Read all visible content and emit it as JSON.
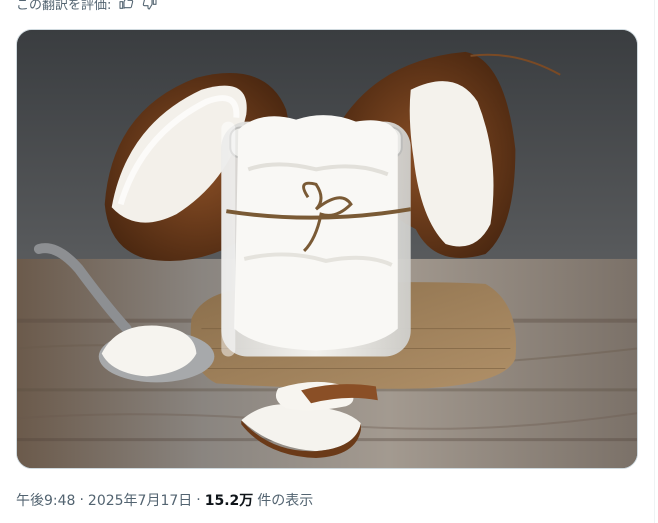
{
  "translation": {
    "rate_label": "この翻訳を評価:"
  },
  "tweet_meta": {
    "time": "午後9:48",
    "separator": "·",
    "date": "2025年7月17日",
    "views_count": "15.2万",
    "views_label": "件の表示"
  },
  "icons": {
    "thumbs_up": "thumbs-up-icon",
    "thumbs_down": "thumbs-down-icon"
  }
}
